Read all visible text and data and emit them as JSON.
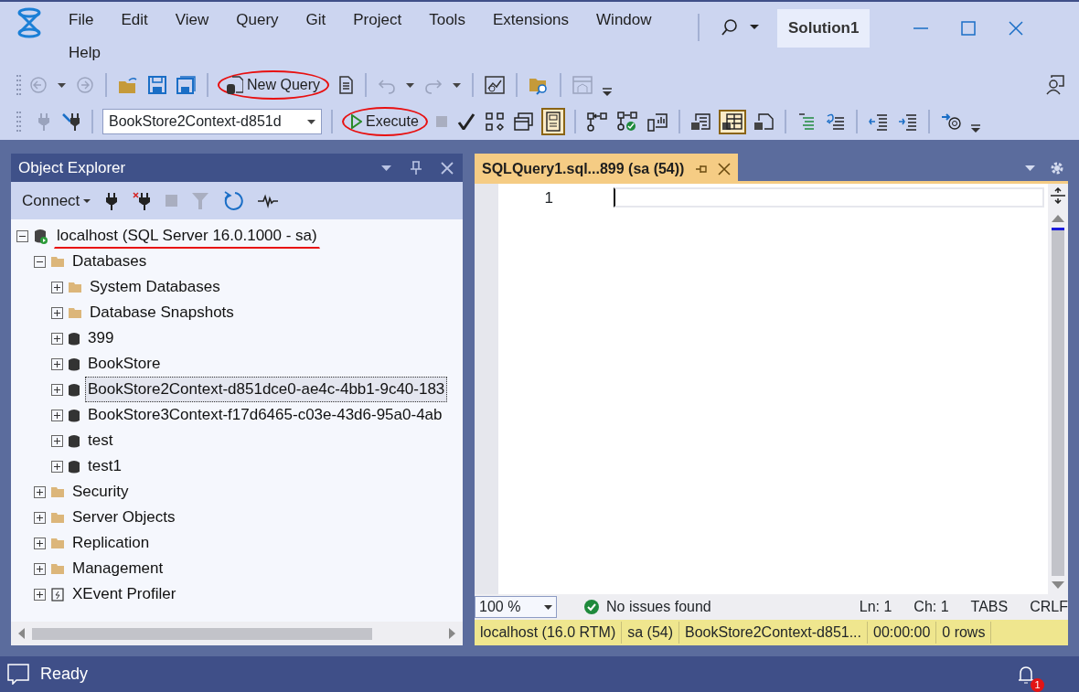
{
  "menu": [
    "File",
    "Edit",
    "View",
    "Query",
    "Git",
    "Project",
    "Tools",
    "Extensions",
    "Window",
    "Help"
  ],
  "solution_name": "Solution1",
  "toolbar": {
    "new_query": {
      "label": "New Query",
      "circled": true
    },
    "database": {
      "value": "BookStore2Context-d851d"
    },
    "execute": {
      "label": "Execute",
      "circled": true
    }
  },
  "object_explorer": {
    "title": "Object Explorer",
    "connect_label": "Connect",
    "tree": [
      {
        "label": "localhost (SQL Server 16.0.1000 - sa)",
        "kind": "server",
        "expanded": true,
        "selected": false,
        "underlined": true,
        "children": [
          {
            "label": "Databases",
            "kind": "folder",
            "expanded": true,
            "selected": false,
            "children": [
              {
                "label": "System Databases",
                "kind": "folder",
                "expanded": false,
                "selected": false
              },
              {
                "label": "Database Snapshots",
                "kind": "folder",
                "expanded": false,
                "selected": false
              },
              {
                "label": "399",
                "kind": "database",
                "expanded": false,
                "selected": false
              },
              {
                "label": "BookStore",
                "kind": "database",
                "expanded": false,
                "selected": false
              },
              {
                "label": "BookStore2Context-d851dce0-ae4c-4bb1-9c40-183",
                "kind": "database",
                "expanded": false,
                "selected": true
              },
              {
                "label": "BookStore3Context-f17d6465-c03e-43d6-95a0-4ab",
                "kind": "database",
                "expanded": false,
                "selected": false
              },
              {
                "label": "test",
                "kind": "database",
                "expanded": false,
                "selected": false
              },
              {
                "label": "test1",
                "kind": "database",
                "expanded": false,
                "selected": false
              }
            ]
          },
          {
            "label": "Security",
            "kind": "folder",
            "expanded": false,
            "selected": false
          },
          {
            "label": "Server Objects",
            "kind": "folder",
            "expanded": false,
            "selected": false
          },
          {
            "label": "Replication",
            "kind": "folder",
            "expanded": false,
            "selected": false
          },
          {
            "label": "Management",
            "kind": "folder",
            "expanded": false,
            "selected": false
          },
          {
            "label": "XEvent Profiler",
            "kind": "profiler",
            "expanded": false,
            "selected": false
          }
        ]
      }
    ]
  },
  "editor": {
    "tab_title": "SQLQuery1.sql...899 (sa (54))",
    "line_numbers": [
      "1"
    ],
    "zoom": "100 %",
    "issues": "No issues found",
    "position": [
      "Ln: 1",
      "Ch: 1",
      "TABS",
      "CRLF"
    ],
    "query_status": [
      "localhost (16.0 RTM)",
      "sa (54)",
      "BookStore2Context-d851...",
      "00:00:00",
      "0 rows"
    ]
  },
  "status_bar": {
    "text": "Ready",
    "notifications": "1"
  }
}
